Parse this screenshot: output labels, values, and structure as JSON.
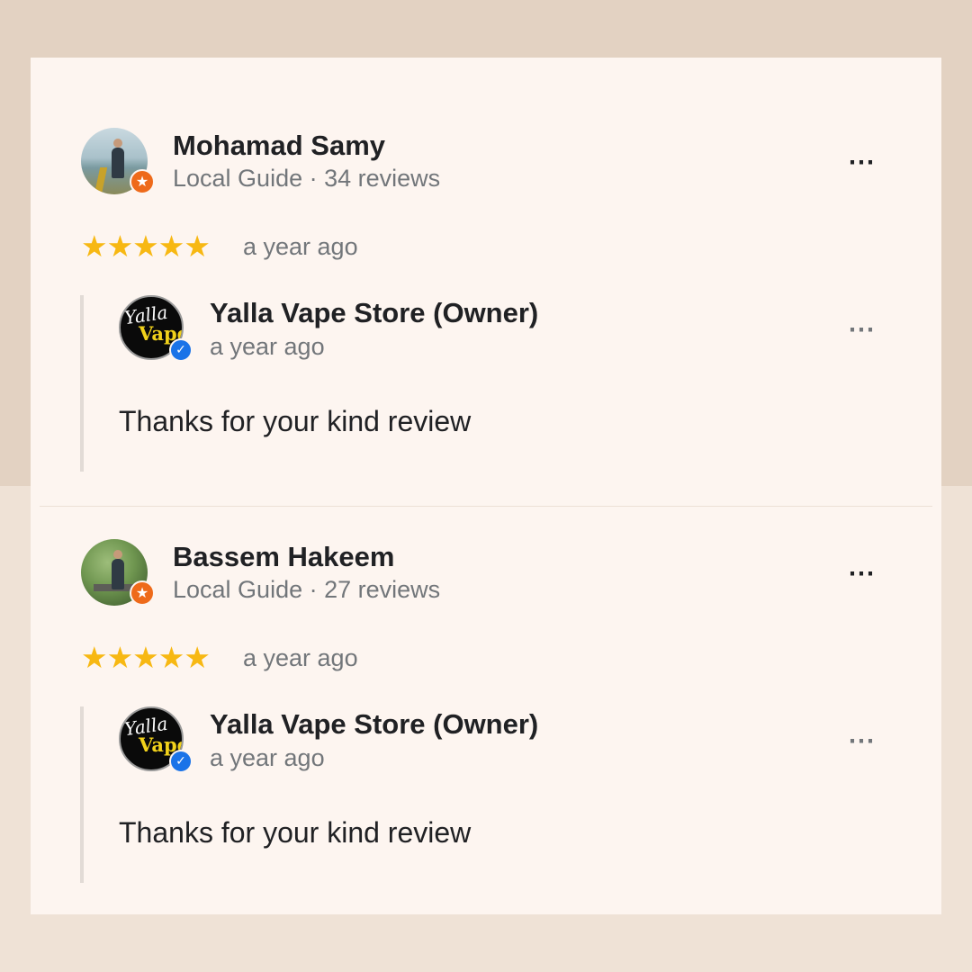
{
  "colors": {
    "star": "#f7b813",
    "local_guide_badge": "#ee6a1a",
    "verified_badge": "#1a73e8",
    "text_primary": "#202124",
    "text_secondary": "#72767a"
  },
  "reviews": [
    {
      "reviewer_name": "Mohamad Samy",
      "reviewer_meta": "Local Guide · 34 reviews",
      "rating": 5,
      "stars": "★★★★★",
      "time": "a year ago",
      "more_icon": "⋯",
      "badge_icon": "★",
      "owner_reply": {
        "logo_line1": "Yalla",
        "logo_line2": "Vape",
        "name": "Yalla Vape Store (Owner)",
        "time": "a year ago",
        "verified_icon": "✓",
        "more_icon": "⋯",
        "text": "Thanks for your kind review"
      }
    },
    {
      "reviewer_name": "Bassem Hakeem",
      "reviewer_meta": "Local Guide · 27 reviews",
      "rating": 5,
      "stars": "★★★★★",
      "time": "a year ago",
      "more_icon": "⋯",
      "badge_icon": "★",
      "owner_reply": {
        "logo_line1": "Yalla",
        "logo_line2": "Vape",
        "name": "Yalla Vape Store (Owner)",
        "time": "a year ago",
        "verified_icon": "✓",
        "more_icon": "⋯",
        "text": "Thanks for your kind review"
      }
    }
  ]
}
